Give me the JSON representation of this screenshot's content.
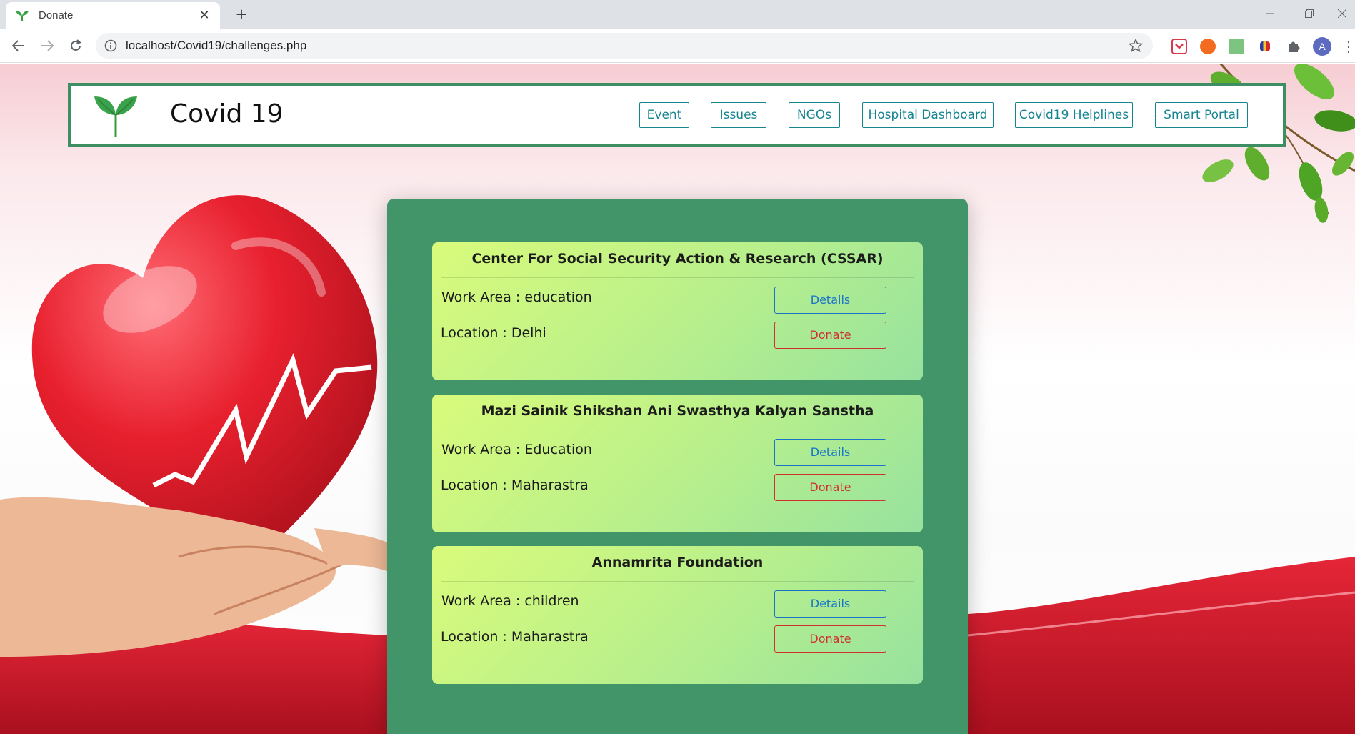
{
  "browser": {
    "tab_title": "Donate",
    "url": "localhost/Covid19/challenges.php",
    "profile_initial": "A"
  },
  "header": {
    "brand": "Covid 19",
    "nav": [
      {
        "label": "Event"
      },
      {
        "label": "Issues"
      },
      {
        "label": "NGOs"
      },
      {
        "label": "Hospital Dashboard"
      },
      {
        "label": "Covid19 Helplines"
      },
      {
        "label": "Smart Portal"
      }
    ]
  },
  "ngos": [
    {
      "name": "Center For Social Security Action & Research (CSSAR)",
      "work_area": "Work Area : education",
      "location": "Location : Delhi",
      "details_label": "Details",
      "donate_label": "Donate"
    },
    {
      "name": "Mazi Sainik Shikshan Ani Swasthya Kalyan Sanstha",
      "work_area": "Work Area : Education",
      "location": "Location : Maharastra",
      "details_label": "Details",
      "donate_label": "Donate"
    },
    {
      "name": "Annamrita Foundation",
      "work_area": "Work Area : children",
      "location": "Location : Maharastra",
      "details_label": "Details",
      "donate_label": "Donate"
    }
  ],
  "colors": {
    "brand_green": "#3d8f63",
    "panel_green": "#429569",
    "nav_teal": "#16848f",
    "details_blue": "#1a73c9",
    "donate_red": "#d0302f"
  },
  "icons": [
    "sprout-favicon",
    "close-icon",
    "plus-icon",
    "back-arrow-icon",
    "forward-arrow-icon",
    "reload-icon",
    "info-icon",
    "star-icon",
    "minimize-icon",
    "restore-icon",
    "close-window-icon",
    "puzzle-icon",
    "kebab-menu-icon",
    "sprout-logo",
    "heart-in-hand-illustration",
    "leaves-illustration"
  ]
}
